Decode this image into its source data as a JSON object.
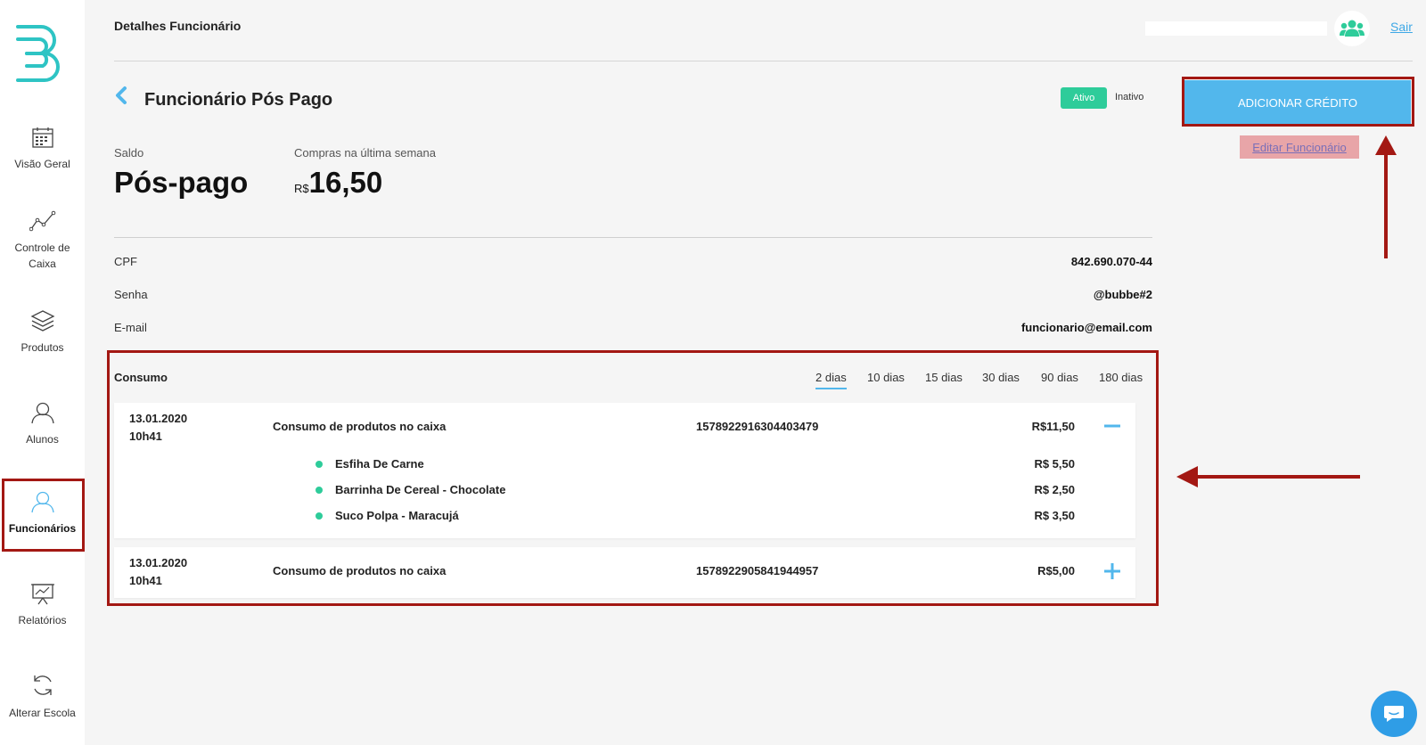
{
  "sidebar": {
    "logo": "brand-logo",
    "items": [
      {
        "label": "Visão Geral",
        "icon": "calendar-icon"
      },
      {
        "label": "Controle de Caixa",
        "icon": "line-chart-icon"
      },
      {
        "label": "Produtos",
        "icon": "layers-icon"
      },
      {
        "label": "Alunos",
        "icon": "user-icon"
      },
      {
        "label": "Funcionários",
        "icon": "user-icon"
      },
      {
        "label": "Relatórios",
        "icon": "presentation-icon"
      },
      {
        "label": "Alterar Escola",
        "icon": "refresh-icon"
      }
    ]
  },
  "header": {
    "title": "Detalhes Funcionário",
    "logout": "Sair",
    "avatar_icon": "users-icon"
  },
  "page": {
    "title": "Funcionário Pós Pago",
    "status_active": "Ativo",
    "status_inactive": "Inativo"
  },
  "balance": {
    "label": "Saldo",
    "value": "Pós-pago",
    "purchases_label": "Compras na última semana",
    "purchases_currency": "R$",
    "purchases_value": "16,50"
  },
  "info": {
    "cpf_label": "CPF",
    "cpf_value": "842.690.070-44",
    "password_label": "Senha",
    "password_value": "@bubbe#2",
    "email_label": "E-mail",
    "email_value": "funcionario@email.com"
  },
  "actions": {
    "add_credit": "ADICIONAR CRÉDITO",
    "edit": "Editar Funcionário"
  },
  "consumption": {
    "title": "Consumo",
    "periods": [
      "2 dias",
      "10 dias",
      "15 dias",
      "30 dias",
      "90 dias",
      "180 dias"
    ],
    "active_period": "2 dias",
    "entries": [
      {
        "date": "13.01.2020",
        "time": "10h41",
        "description": "Consumo de produtos no caixa",
        "code": "1578922916304403479",
        "amount": "R$11,50",
        "expanded": true,
        "items": [
          {
            "name": "Esfiha De Carne",
            "price": "R$ 5,50"
          },
          {
            "name": "Barrinha De Cereal - Chocolate",
            "price": "R$ 2,50"
          },
          {
            "name": "Suco Polpa - Maracujá",
            "price": "R$ 3,50"
          }
        ]
      },
      {
        "date": "13.01.2020",
        "time": "10h41",
        "description": "Consumo de produtos no caixa",
        "code": "1578922905841944957",
        "amount": "R$5,00",
        "expanded": false
      }
    ]
  },
  "colors": {
    "accent_blue": "#52b7ec",
    "active_green": "#2ecc9a",
    "highlight_red": "#a31813",
    "edit_bg": "#e8a5a8"
  }
}
